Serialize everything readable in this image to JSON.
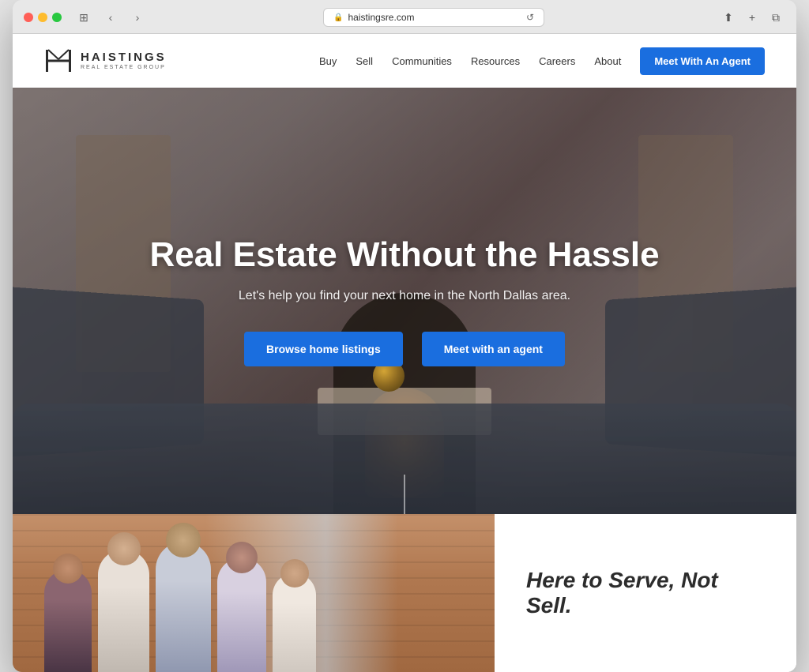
{
  "browser": {
    "url": "haistingsre.com",
    "back_btn": "‹",
    "forward_btn": "›"
  },
  "nav": {
    "logo_name": "HAISTINGS",
    "logo_sub": "REAL ESTATE GROUP",
    "links": [
      {
        "label": "Buy",
        "id": "buy"
      },
      {
        "label": "Sell",
        "id": "sell"
      },
      {
        "label": "Communities",
        "id": "communities"
      },
      {
        "label": "Resources",
        "id": "resources"
      },
      {
        "label": "Careers",
        "id": "careers"
      },
      {
        "label": "About",
        "id": "about"
      }
    ],
    "cta_label": "Meet With An Agent"
  },
  "hero": {
    "title": "Real Estate Without the Hassle",
    "subtitle": "Let's help you find your next home in the North Dallas area.",
    "btn_listings": "Browse home listings",
    "btn_agent": "Meet with an agent"
  },
  "below_fold": {
    "tagline": "Here to Serve, Not Sell."
  }
}
